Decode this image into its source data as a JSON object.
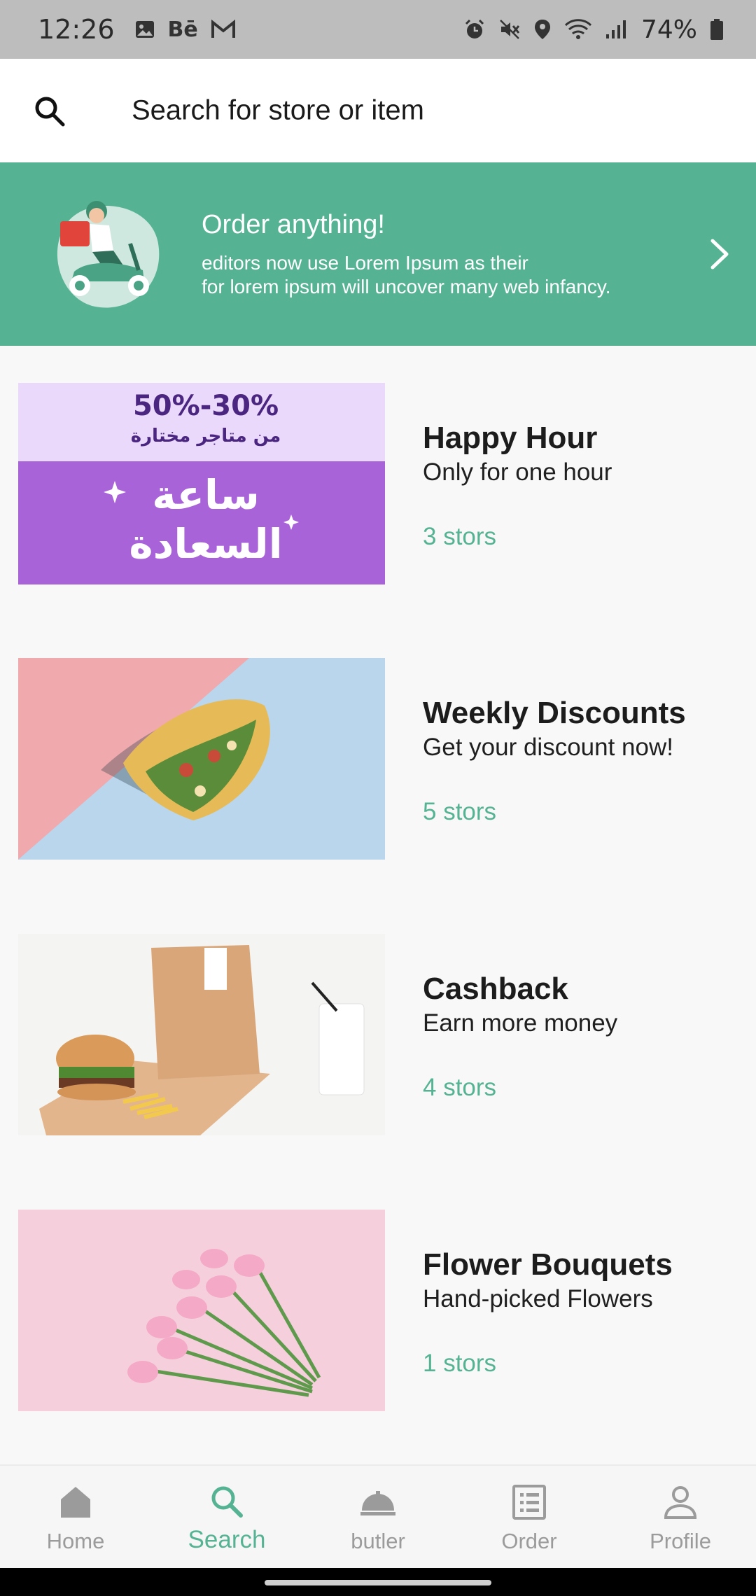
{
  "status_bar": {
    "time": "12:26",
    "behance_label": "Bē",
    "battery_percent": "74%"
  },
  "search": {
    "placeholder": "Search for store or item"
  },
  "banner": {
    "title": "Order anything!",
    "description_line1": "editors now use Lorem Ipsum as their",
    "description_line2": "for lorem ipsum will uncover many web infancy.",
    "background_color": "#55b394"
  },
  "offers": [
    {
      "title": "Happy Hour",
      "subtitle": "Only for one hour",
      "count": "3 stors",
      "image_text_top": "50%-30%",
      "image_text_sub": "من متاجر مختارة",
      "image_text_main1": "ساعة",
      "image_text_main2": "السعادة"
    },
    {
      "title": "Weekly Discounts",
      "subtitle": "Get your discount now!",
      "count": "5 stors"
    },
    {
      "title": "Cashback",
      "subtitle": "Earn more money",
      "count": "4 stors"
    },
    {
      "title": "Flower Bouquets",
      "subtitle": "Hand-picked Flowers",
      "count": "1 stors"
    }
  ],
  "bottom_nav": {
    "items": [
      {
        "label": "Home",
        "icon": "home-icon"
      },
      {
        "label": "Search",
        "icon": "search-icon",
        "active": true
      },
      {
        "label": "butler",
        "icon": "cloche-icon"
      },
      {
        "label": "Order",
        "icon": "list-icon"
      },
      {
        "label": "Profile",
        "icon": "person-icon"
      }
    ]
  },
  "colors": {
    "accent": "#55b394",
    "inactive": "#9b9b9b"
  }
}
